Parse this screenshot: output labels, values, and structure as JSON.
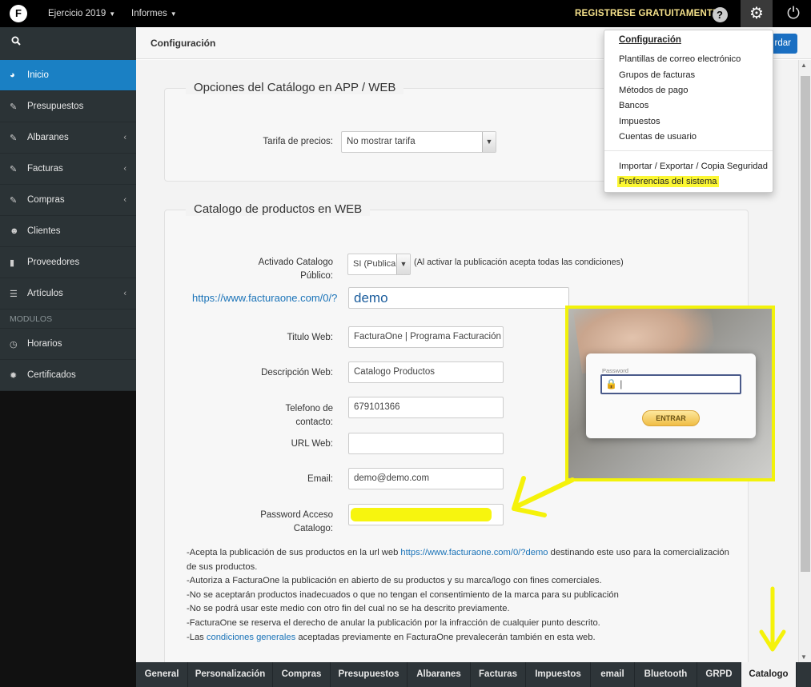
{
  "topbar": {
    "logo": "F",
    "menu_year": "Ejercicio 2019",
    "menu_reports": "Informes",
    "register": "REGISTRESE GRATUITAMENTE",
    "help_glyph": "?",
    "gear_glyph": "⚙",
    "power_glyph": "⏻"
  },
  "sidebar": {
    "search_glyph": "🔍",
    "items": [
      {
        "label": "Inicio",
        "icon": "dashboard-icon"
      },
      {
        "label": "Presupuestos",
        "icon": "edit-icon"
      },
      {
        "label": "Albaranes",
        "icon": "edit-icon"
      },
      {
        "label": "Facturas",
        "icon": "edit-icon"
      },
      {
        "label": "Compras",
        "icon": "edit-icon"
      },
      {
        "label": "Clientes",
        "icon": "users-icon"
      },
      {
        "label": "Proveedores",
        "icon": "bar-chart-icon"
      },
      {
        "label": "Artículos",
        "icon": "list-icon"
      },
      {
        "label": "Horarios",
        "icon": "clock-icon"
      },
      {
        "label": "Certificados",
        "icon": "certificate-icon"
      }
    ],
    "section_modulos": "MODULOS"
  },
  "header": {
    "title": "Configuración",
    "save_label": "rdar"
  },
  "catalog_options": {
    "legend": "Opciones del Catálogo en APP / WEB",
    "price_label": "Tarifa de precios:",
    "price_value": "No mostrar tarifa"
  },
  "web_catalog": {
    "legend": "Catalogo de productos en WEB",
    "active_label_1": "Activado Catalogo",
    "active_label_2": "Público:",
    "active_value": "SI (Publica",
    "active_note": "(Al activar la publicación acepta todas las condiciones)",
    "url_prefix": "https://www.facturaone.com/0/?",
    "url_value": "demo",
    "title_label": "Titulo Web:",
    "title_value": "FacturaOne | Programa Facturación O",
    "desc_label": "Descripción Web:",
    "desc_value": "Catalogo Productos",
    "phone_label_1": "Telefono de",
    "phone_label_2": "contacto:",
    "phone_value": "679101366",
    "url_label": "URL Web:",
    "url_web_value": "",
    "email_label": "Email:",
    "email_value": "demo@demo.com",
    "pass_label_1": "Password Acceso",
    "pass_label_2": "Catalogo:"
  },
  "terms": {
    "l1a": "-Acepta la publicación de sus productos en la url web ",
    "l1link": "https://www.facturaone.com/0/?demo",
    "l1b": " destinando este uso para la comercialización",
    "l1c": "de sus productos.",
    "l2": "-Autoriza a FacturaOne la publicación en abierto de su productos y su marca/logo con fines comerciales.",
    "l3": "-No se aceptarán productos inadecuados o que no tengan el consentimiento de la marca para su publicación",
    "l4": "-No se podrá usar este medio con otro fin del cual no se ha descrito previamente.",
    "l5": "-FacturaOne se reserva el derecho de anular la publicación por la infracción de cualquier punto descrito.",
    "l6a": "-Las ",
    "l6link": "condiciones generales",
    "l6b": " aceptadas previamente en FacturaOne prevalecerán también en esta web."
  },
  "dropdown": {
    "heading": "Configuración",
    "items": [
      "Plantillas de correo electrónico",
      "Grupos de facturas",
      "Métodos de pago",
      "Bancos",
      "Impuestos",
      "Cuentas de usuario"
    ],
    "import_export": "Importar / Exportar / Copia Seguridad",
    "preferences": "Preferencias del sistema"
  },
  "overlay": {
    "password_label": "Password",
    "login_button": "ENTRAR"
  },
  "tabs": [
    "General",
    "Personalización",
    "Compras",
    "Presupuestos",
    "Albaranes",
    "Facturas",
    "Impuestos",
    "email",
    "Bluetooth",
    "GRPD",
    "Catalogo"
  ],
  "colors": {
    "accent": "#1a80c4",
    "highlight": "#f2f20a",
    "topbar": "#000000",
    "sidebar": "#2b3336"
  }
}
